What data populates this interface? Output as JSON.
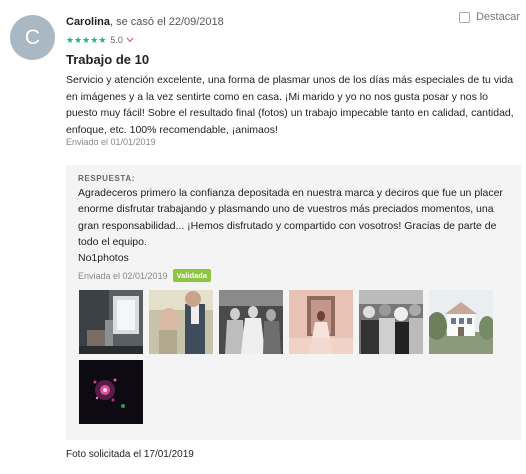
{
  "reviewer": {
    "avatar_letter": "C",
    "name": "Carolina",
    "married_text": ", se casó el 22/09/2018"
  },
  "rating": {
    "value": "5.0",
    "stars": 5,
    "max": 5
  },
  "save_label": "Destacar",
  "review": {
    "title": "Trabajo de 10",
    "text": "Servicio y atención excelente, una forma de plasmar unos de los días más especiales de tu vida en imágenes y a la vez sentirte como en casa. ¡Mi marido y yo no nos gusta posar y nos lo puesto muy fácil! Sobre el resultado final (fotos) un trabajo impecable tanto en calidad, cantidad, enfoque, etc. 100% recomendable, ¡animaos!",
    "sent": "Enviado el 01/01/2019"
  },
  "response": {
    "label": "RESPUESTA:",
    "text": "Agradeceros primero la confianza depositada en nuestra marca y deciros que fue un placer enorme disfrutar trabajando y plasmando uno de vuestros más preciados momentos, una gran responsabilidad... ¡Hemos disfrutado y compartido con vosotros! Gracias de parte de todo el equipo.",
    "signature": "No1photos",
    "sent": "Enviada el 02/01/2019",
    "status_badge": "Validada"
  },
  "photos": [
    {
      "name": "photo-1",
      "scene": "interior with window light"
    },
    {
      "name": "photo-2",
      "scene": "groom adjusting tie"
    },
    {
      "name": "photo-3",
      "scene": "black and white bridesmaids"
    },
    {
      "name": "photo-4",
      "scene": "bride in doorway"
    },
    {
      "name": "photo-5",
      "scene": "black and white crowd"
    },
    {
      "name": "photo-6",
      "scene": "white house with trees"
    },
    {
      "name": "photo-7",
      "scene": "fireworks at night"
    }
  ],
  "footer": {
    "text": "Foto solicitada el 17/01/2019"
  },
  "colors": {
    "star": "#22b573",
    "badge": "#8cc63f",
    "avatar": "#a9b8c3",
    "response_bg": "#f4f4f4"
  }
}
